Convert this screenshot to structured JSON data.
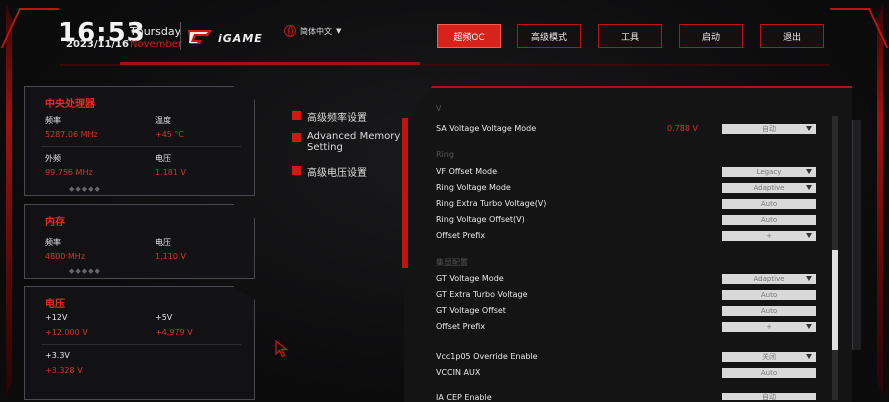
{
  "header": {
    "time": "16:53",
    "date": "2023/11/16",
    "weekday": "Thursday",
    "month": "November",
    "logo_text": "iGAME",
    "language": "简体中文"
  },
  "nav": {
    "tabs": [
      {
        "label": "超频OC",
        "active": true
      },
      {
        "label": "高级模式",
        "active": false
      },
      {
        "label": "工具",
        "active": false
      },
      {
        "label": "启动",
        "active": false
      },
      {
        "label": "退出",
        "active": false
      }
    ]
  },
  "cpu_box": {
    "title": "中央处理器",
    "freq_label": "频率",
    "freq_value": "5287.06 MHz",
    "temp_label": "温度",
    "temp_value": "+45 °C",
    "ext_label": "外频",
    "ext_value": "99.756 MHz",
    "volt_label": "电压",
    "volt_value": "1.181 V"
  },
  "mem_box": {
    "title": "内存",
    "freq_label": "频率",
    "freq_value": "4800 MHz",
    "volt_label": "电压",
    "volt_value": "1.110 V"
  },
  "volt_box": {
    "title": "电压",
    "v12_label": "+12V",
    "v12_value": "+12.000 V",
    "v5_label": "+5V",
    "v5_value": "+4.979 V",
    "v33_label": "+3.3V",
    "v33_value": "+3.328 V"
  },
  "menu": {
    "items": [
      "高级频率设置",
      "Advanced Memory Setting",
      "高级电压设置"
    ]
  },
  "panel": {
    "top_partial": "V",
    "sa_label": "SA Voltage Voltage Mode",
    "sa_value": "0.788 V",
    "sa_select": "自动",
    "ring_section": "Ring",
    "vf_offset_label": "VF Offset Mode",
    "vf_offset_select": "Legacy",
    "ring_mode_label": "Ring Voltage Mode",
    "ring_mode_select": "Adaptive",
    "ring_turbo_label": "Ring Extra Turbo Voltage(V)",
    "ring_turbo_select": "Auto",
    "ring_offset_label": "Ring Voltage Offset(V)",
    "ring_offset_select": "Auto",
    "ring_prefix_label": "Offset Prefix",
    "ring_prefix_select": "+",
    "gt_section": "集显配置",
    "gt_mode_label": "GT Voltage Mode",
    "gt_mode_select": "Adaptive",
    "gt_turbo_label": "GT Extra Turbo Voltage",
    "gt_turbo_select": "Auto",
    "gt_offset_label": "GT Voltage Offset",
    "gt_offset_select": "Auto",
    "gt_prefix_label": "Offset Prefix",
    "gt_prefix_select": "+",
    "vcc_label": "Vcc1p05 Override Enable",
    "vcc_select": "关闭",
    "vccin_label": "VCCIN AUX",
    "vccin_select": "Auto",
    "iacep_label": "IA CEP Enable",
    "iacep_select": "自动"
  },
  "colors": {
    "accent": "#d21812",
    "value_red": "#d8312a",
    "panel_bg": "#141415"
  }
}
